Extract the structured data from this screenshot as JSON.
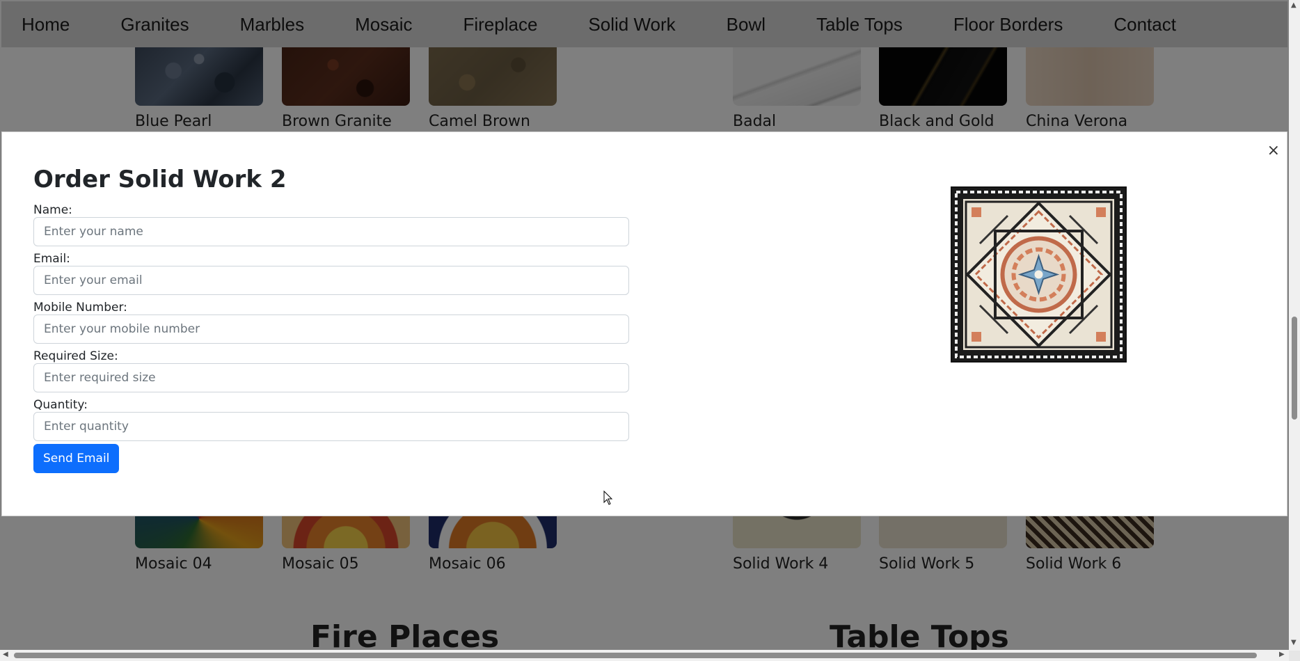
{
  "nav": {
    "items": [
      "Home",
      "Granites",
      "Marbles",
      "Mosaic",
      "Fireplace",
      "Solid Work",
      "Bowl",
      "Table Tops",
      "Floor Borders",
      "Contact"
    ]
  },
  "gallery_top": {
    "granites": [
      "Blue Pearl",
      "Brown Granite",
      "Camel Brown"
    ],
    "marbles": [
      "Badal",
      "Black and Gold",
      "China Verona"
    ]
  },
  "gallery_bottom": {
    "mosaics": [
      "Mosaic 04",
      "Mosaic 05",
      "Mosaic 06"
    ],
    "solid_works": [
      "Solid Work 4",
      "Solid Work 5",
      "Solid Work 6"
    ]
  },
  "sections": {
    "fire_places": "Fire Places",
    "table_tops": "Table Tops"
  },
  "modal": {
    "close_symbol": "×",
    "title": "Order Solid Work 2",
    "fields": {
      "name": {
        "label": "Name:",
        "placeholder": "Enter your name"
      },
      "email": {
        "label": "Email:",
        "placeholder": "Enter your email"
      },
      "mobile": {
        "label": "Mobile Number:",
        "placeholder": "Enter your mobile number"
      },
      "size": {
        "label": "Required Size:",
        "placeholder": "Enter required size"
      },
      "quantity": {
        "label": "Quantity:",
        "placeholder": "Enter quantity"
      }
    },
    "submit_label": "Send Email"
  },
  "colors": {
    "primary_button": "#0d6efd",
    "navbar_bg": "#d9d9d9",
    "backdrop": "rgba(0,0,0,0.5)"
  },
  "icons": {
    "close": "close-icon",
    "cursor": "mouse-pointer-icon"
  }
}
